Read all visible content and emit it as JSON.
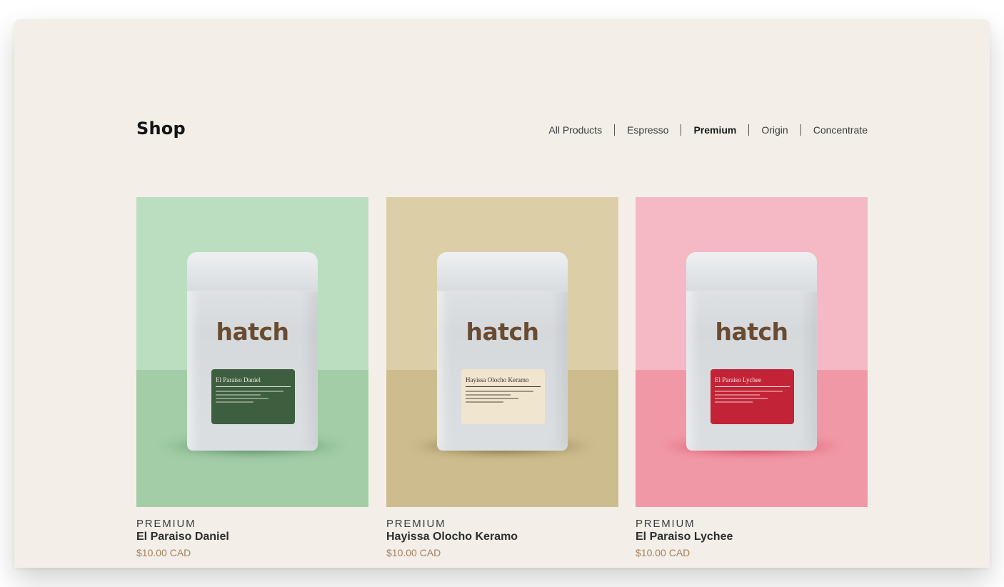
{
  "page": {
    "title": "Shop"
  },
  "filters": [
    {
      "label": "All Products",
      "active": false
    },
    {
      "label": "Espresso",
      "active": false
    },
    {
      "label": "Premium",
      "active": true
    },
    {
      "label": "Origin",
      "active": false
    },
    {
      "label": "Concentrate",
      "active": false
    }
  ],
  "products": [
    {
      "category": "PREMIUM",
      "name": "El Paraiso Daniel",
      "price": "$10.00 CAD",
      "brand": "hatch",
      "label_title": "El Paraiso Daniel",
      "colors": {
        "wall": "#bbdec0",
        "floor": "#a2cda6",
        "shadow": "#2f6a39",
        "label": "#3d5e3f",
        "label_text": "#e7eadf"
      }
    },
    {
      "category": "PREMIUM",
      "name": "Hayissa Olocho Keramo",
      "price": "$10.00 CAD",
      "brand": "hatch",
      "label_title": "Hayissa Olocho Keramo",
      "colors": {
        "wall": "#dccea7",
        "floor": "#cdbd8e",
        "shadow": "#5e4a1f",
        "label": "#f0e6cf",
        "label_text": "#3a3226"
      }
    },
    {
      "category": "PREMIUM",
      "name": "El Paraiso Lychee",
      "price": "$10.00 CAD",
      "brand": "hatch",
      "label_title": "El Paraiso Lychee",
      "colors": {
        "wall": "#f4b9c4",
        "floor": "#f198a6",
        "shadow": "#c61d3a",
        "label": "#c32336",
        "label_text": "#fbe4e7"
      }
    }
  ]
}
